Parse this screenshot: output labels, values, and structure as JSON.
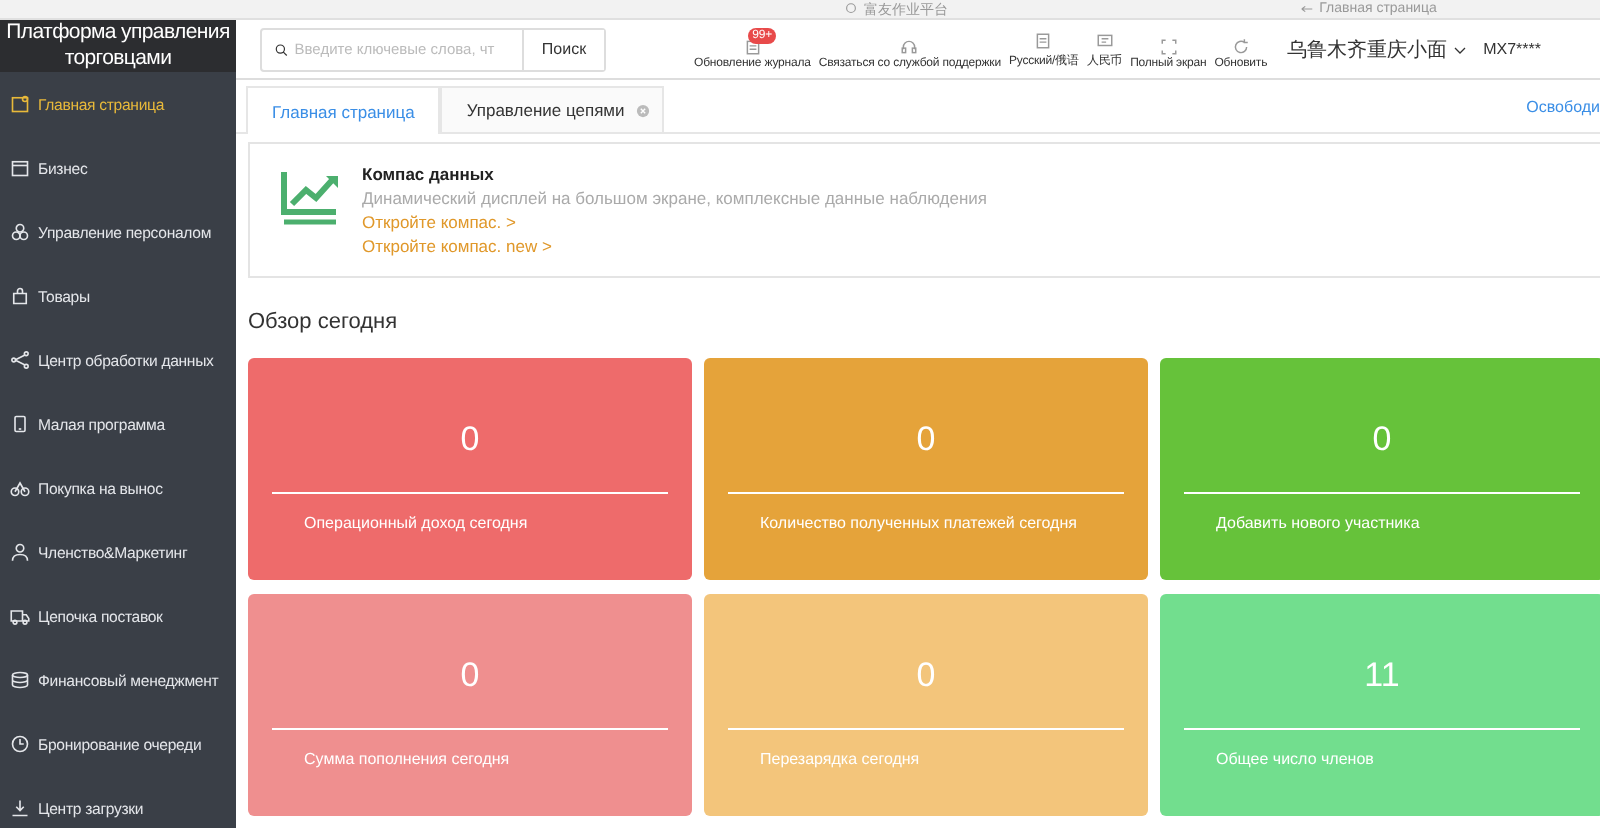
{
  "browser_tabs": [
    {
      "label": "富友作业平台"
    },
    {
      "label": "Главная страница"
    }
  ],
  "sidebar": {
    "title": "Платформа управления торговцами",
    "items": [
      {
        "label": "Главная страница",
        "selected": true
      },
      {
        "label": "Бизнес",
        "selected": false
      },
      {
        "label": "Управление персоналом",
        "selected": false
      },
      {
        "label": "Товары",
        "selected": false
      },
      {
        "label": "Центр обработки данных",
        "selected": false
      },
      {
        "label": "Малая программа",
        "selected": false
      },
      {
        "label": "Покупка на вынос",
        "selected": false
      },
      {
        "label": "Членство&Маркетинг",
        "selected": false
      },
      {
        "label": "Цепочка поставок",
        "selected": false
      },
      {
        "label": "Финансовый менеджмент",
        "selected": false
      },
      {
        "label": "Бронирование очереди",
        "selected": false
      },
      {
        "label": "Центр загрузки",
        "selected": false
      }
    ]
  },
  "header": {
    "search": {
      "placeholder": "Введите ключевые слова, чт",
      "button": "Поиск"
    },
    "tools": [
      {
        "label": "Обновление журнала",
        "badge": "99+"
      },
      {
        "label": "Связаться со службой поддержки"
      },
      {
        "label": "Русский/俄语"
      },
      {
        "label": "人民币"
      },
      {
        "label": "Полный экран"
      },
      {
        "label": "Обновить"
      }
    ],
    "store": "乌鲁木齐重庆小面",
    "user": "MX7****"
  },
  "tabs": [
    {
      "label": "Главная страница",
      "selected": true,
      "closable": false
    },
    {
      "label": "Управление цепями",
      "selected": false,
      "closable": true
    }
  ],
  "release_link": "Освободи",
  "compass": {
    "title": "Компас данных",
    "description": "Динамический дисплей на большом экране, комплексные данные наблюдения",
    "links": [
      "Откройте компас. >",
      "Откройте компас. new >"
    ]
  },
  "overview": {
    "title": "Обзор сегодня",
    "cards": [
      {
        "value": "0",
        "label": "Операционный доход сегодня",
        "color": "#ee6b6b"
      },
      {
        "value": "0",
        "label": "Количество полученных платежей сегодня",
        "color": "#e5a33a"
      },
      {
        "value": "0",
        "label": "Добавить нового участника",
        "color": "#66c23a"
      },
      {
        "value": "0",
        "label": "Сумма пополнения сегодня",
        "color": "#ef8f8f"
      },
      {
        "value": "0",
        "label": "Перезарядка сегодня",
        "color": "#f3c57b"
      },
      {
        "value": "11",
        "label": "Общее число членов",
        "color": "#72de8e"
      }
    ]
  }
}
